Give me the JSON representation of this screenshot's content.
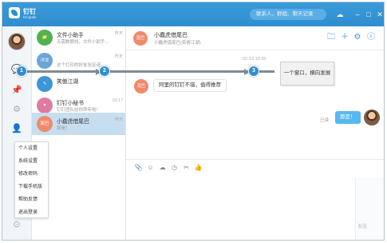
{
  "app": {
    "name": "钉钉",
    "subtitle": "Dingtalk"
  },
  "search": {
    "placeholder": "联系人、群组、聊天记录"
  },
  "titlebar_icons": [
    "cloud-icon",
    "minimize-icon",
    "maximize-icon",
    "close-icon"
  ],
  "rail": {
    "icons": [
      "chat-icon",
      "pin-icon",
      "settings-cog-icon",
      "contacts-icon",
      "more-icon"
    ]
  },
  "conversations": [
    {
      "avatar_text": "",
      "name": "文件小助手",
      "preview": "无需数据线，文件小助手...",
      "time": "昨天",
      "avatar_color": "#4fb34f"
    },
    {
      "avatar_text": "洋龙",
      "name": "",
      "preview": "这个打印的好友验证请...",
      "time": "昨天",
      "avatar_color": "#6aa4d8"
    },
    {
      "avatar_text": "",
      "name": "笑傲江湖",
      "preview": "",
      "time": "",
      "avatar_color": "#3d97d4"
    },
    {
      "avatar_text": "",
      "name": "钉钉小秘书",
      "preview": "钉钉团队给你拜年啦！",
      "time": "02-17",
      "avatar_color": "#e07aa0"
    },
    {
      "avatar_text": "尾巴",
      "name": "小蠢虎借尾巴",
      "preview": "那是！",
      "time": "昨天",
      "avatar_color": "#f08a6a"
    }
  ],
  "chat": {
    "avatar_text": "尾巴",
    "name": "小蠢虎借尾巴",
    "subtitle": "小蠢虎借尾巴(英睿江湖)",
    "timestamp": "02-13 10:39",
    "incoming": "阿里的钉钉不错，值得推荐",
    "outgoing": "那是！",
    "read_status": "已读",
    "send_label": "发送"
  },
  "menu": [
    "个人设置",
    "系统设置",
    "修改密码",
    "下载手机版",
    "帮助反馈",
    "退出登录"
  ],
  "annotation": {
    "note": "一个窗口，横向发展",
    "markers": [
      "1",
      "2",
      "3"
    ]
  },
  "colors": {
    "brand": "#2f8ed0",
    "selected_row": "#c7def0",
    "outgoing_bubble": "#58b8f2"
  }
}
